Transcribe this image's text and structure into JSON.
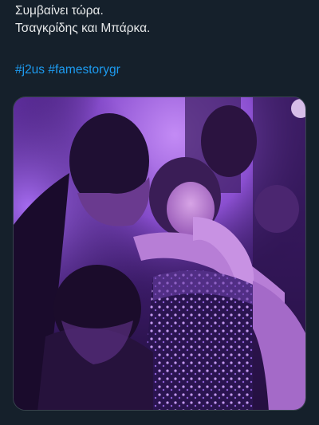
{
  "tweet": {
    "lines": [
      "Συμβαίνει τώρα.",
      "Τσαγκρίδης και Μπάρκα."
    ],
    "hashtags": [
      "#j2us",
      "#famestorygr"
    ]
  },
  "media": {
    "alt": "video-photo"
  },
  "colors": {
    "background": "#15202b",
    "text": "#e7e9ea",
    "link": "#1d9bf0",
    "border": "#38444d"
  }
}
